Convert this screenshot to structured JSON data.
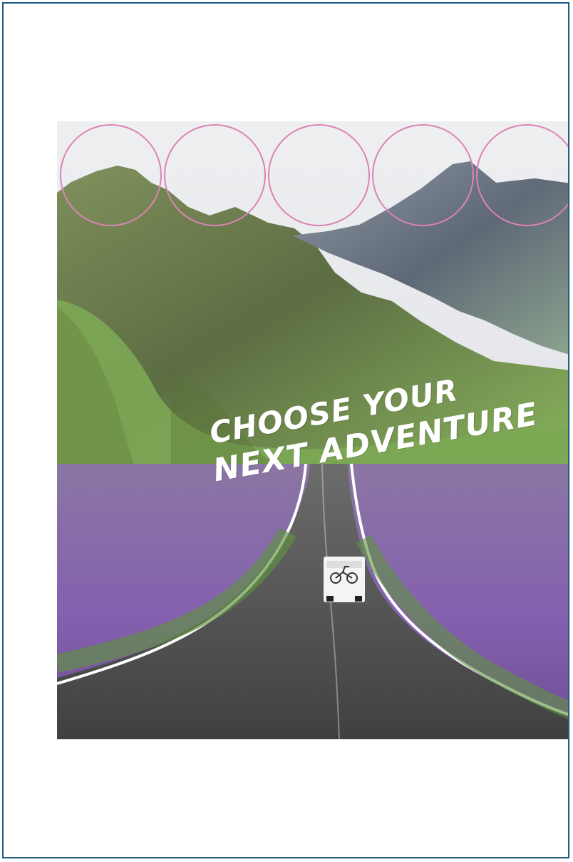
{
  "page": {
    "frame_color": "#1f5a86",
    "background": "#ffffff"
  },
  "hero": {
    "image_name": "scenic-road-camper-image",
    "headline": {
      "line1": "CHOOSE YOUR",
      "line2": "NEXT ADVENTURE"
    },
    "circles_count": 5,
    "circle_color": "#dc83b3"
  }
}
